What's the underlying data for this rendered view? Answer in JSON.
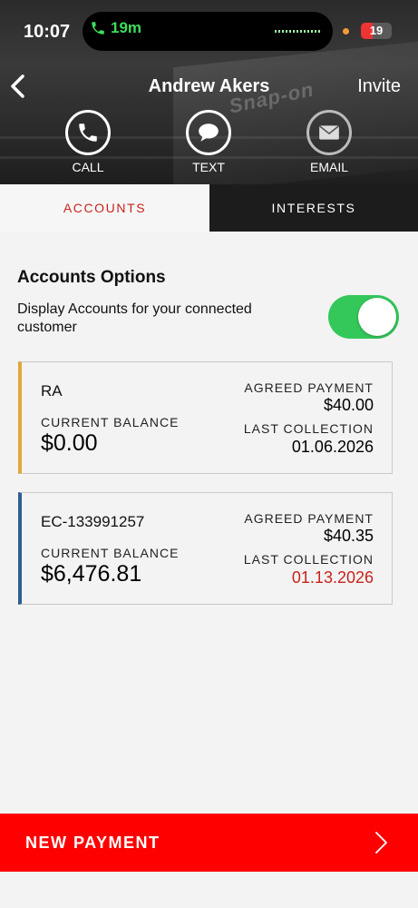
{
  "status_bar": {
    "time": "10:07",
    "call_duration": "19m",
    "battery": "19"
  },
  "header": {
    "title": "Andrew Akers",
    "invite_label": "Invite",
    "background_brand_text": "Snap-on",
    "actions": [
      {
        "label": "CALL",
        "icon": "phone-icon"
      },
      {
        "label": "TEXT",
        "icon": "chat-bubble-icon"
      },
      {
        "label": "EMAIL",
        "icon": "envelope-icon"
      }
    ]
  },
  "tabs": [
    {
      "label": "ACCOUNTS",
      "active": true
    },
    {
      "label": "INTERESTS",
      "active": false
    }
  ],
  "accounts_options": {
    "title": "Accounts Options",
    "toggle_label": "Display Accounts for your connected customer",
    "toggle_on": true
  },
  "accounts": [
    {
      "id": "RA",
      "current_balance_label": "CURRENT BALANCE",
      "current_balance": "$0.00",
      "agreed_payment_label": "AGREED PAYMENT",
      "agreed_payment": "$40.00",
      "last_collection_label": "LAST COLLECTION",
      "last_collection": "01.06.2026",
      "accent_color": "#e2a73b"
    },
    {
      "id": "EC-133991257",
      "current_balance_label": "CURRENT BALANCE",
      "current_balance": "$6,476.81",
      "agreed_payment_label": "AGREED PAYMENT",
      "agreed_payment": "$40.35",
      "last_collection_label": "LAST COLLECTION",
      "last_collection": "01.13.2026",
      "accent_color": "#2e5f8f",
      "last_collection_color": "#c9231b"
    }
  ],
  "footer": {
    "new_payment_label": "NEW PAYMENT",
    "button_color": "#ff0000"
  },
  "colors": {
    "accent_red": "#c9231b",
    "toggle_green": "#34c759"
  }
}
